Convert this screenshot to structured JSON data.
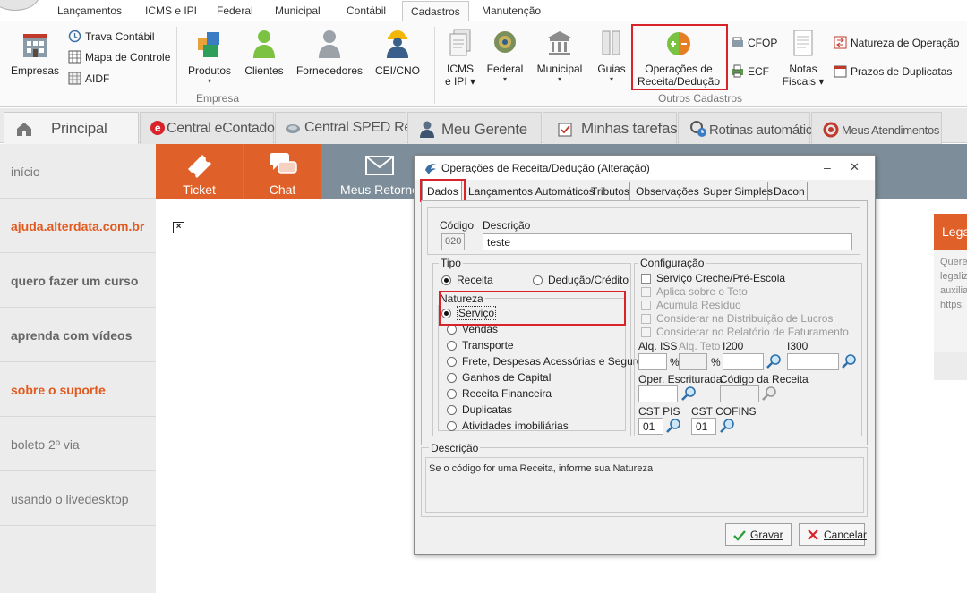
{
  "ribbon": {
    "tabs": [
      "Lançamentos",
      "ICMS e IPI",
      "Federal",
      "Municipal",
      "Contábil",
      "Cadastros",
      "Manutenção"
    ],
    "active_tab": "Cadastros",
    "empresa_group": {
      "label": "Empresa",
      "empresas": "Empresas",
      "trava_contabil": "Trava Contábil",
      "mapa_controle": "Mapa de Controle",
      "aidf": "AIDF",
      "produtos": "Produtos",
      "clientes": "Clientes",
      "fornecedores": "Fornecedores",
      "cei_cno": "CEI/CNO"
    },
    "outros_group": {
      "label": "Outros Cadastros",
      "icms_ipi_line1": "ICMS",
      "icms_ipi_line2": "e IPI",
      "federal": "Federal",
      "municipal": "Municipal",
      "guias": "Guias",
      "operacoes_line1": "Operações de",
      "operacoes_line2": "Receita/Dedução",
      "cfop": "CFOP",
      "ecf": "ECF",
      "notas_line1": "Notas",
      "notas_line2": "Fiscais",
      "natureza_operacao": "Natureza de Operação",
      "prazos_duplicatas": "Prazos de Duplicatas"
    }
  },
  "main_tabs": [
    "Principal",
    "Central eContador",
    "Central SPED Reinf",
    "Meu Gerente",
    "Minhas tarefas",
    "Rotinas automáticas",
    "Meus Atendimentos"
  ],
  "left_nav": [
    "início",
    "ajuda.alterdata.com.br",
    "quero fazer um curso",
    "aprenda com vídeos",
    "sobre o suporte",
    "boleto 2º via",
    "usando o livedesktop"
  ],
  "actions": {
    "ticket": "Ticket",
    "chat": "Chat",
    "meus_retornos": "Meus Retorno"
  },
  "legal_card": {
    "title": "Legal",
    "lines": [
      "Quere",
      "legaliz",
      "auxilia",
      "https:"
    ]
  },
  "dialog": {
    "title": "Operações de Receita/Dedução (Alteração)",
    "tabs": [
      "Dados",
      "Lançamentos Automáticos",
      "Tributos",
      "Observações",
      "Super Simples",
      "Dacon"
    ],
    "codigo_label": "Código",
    "codigo_value": "020",
    "descricao_label": "Descrição",
    "descricao_value": "teste",
    "tipo_label": "Tipo",
    "tipo_options": [
      "Receita",
      "Dedução/Crédito"
    ],
    "natureza_label": "Natureza",
    "natureza_options": [
      "Serviço",
      "Vendas",
      "Transporte",
      "Frete, Despesas Acessórias e Seguro",
      "Ganhos de Capital",
      "Receita Financeira",
      "Duplicatas",
      "Atividades imobiliárias"
    ],
    "configuracao_label": "Configuração",
    "config_options": [
      "Serviço Creche/Pré-Escola",
      "Aplica sobre o Teto",
      "Acumula Resíduo",
      "Considerar na Distribuição de Lucros",
      "Considerar no Relatório de Faturamento"
    ],
    "aliq_iss": "Alq. ISS",
    "aliq_teto": "Alq. Teto",
    "i200": "I200",
    "i300": "I300",
    "percent": "%",
    "oper_escriturada": "Oper. Escriturada",
    "codigo_receita": "Código da Receita",
    "cst_pis": "CST PIS",
    "cst_pis_value": "01",
    "cst_cofins": "CST COFINS",
    "cst_cofins_value": "01",
    "descricao_box_label": "Descrição",
    "descricao_hint": "Se o código for uma Receita, informe sua Natureza",
    "gravar": "Gravar",
    "cancelar": "Cancelar"
  },
  "colors": {
    "highlight": "#d8232a",
    "orange": "#e0602a",
    "slate": "#7d8e9a"
  }
}
